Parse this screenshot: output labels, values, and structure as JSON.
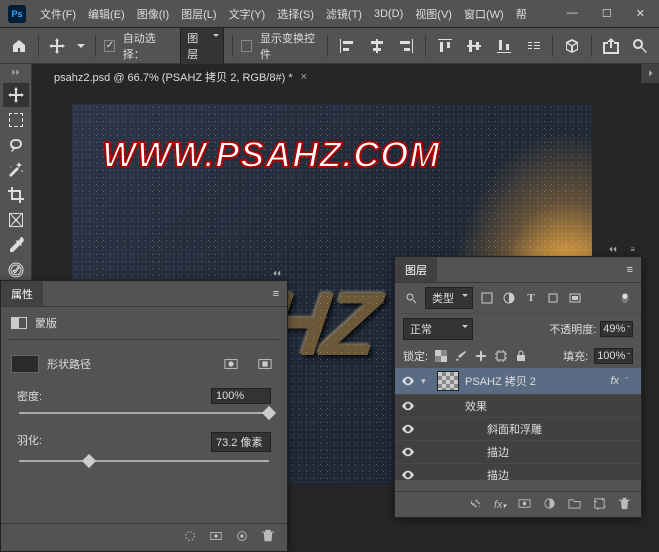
{
  "menu": {
    "file": "文件(F)",
    "edit": "编辑(E)",
    "image": "图像(I)",
    "layer": "图层(L)",
    "type": "文字(Y)",
    "select": "选择(S)",
    "filter": "滤镜(T)",
    "threed": "3D(D)",
    "view": "视图(V)",
    "window": "窗口(W)",
    "help": "帮"
  },
  "options": {
    "autoselect": "自动选择：",
    "target": "图层",
    "show_transform": "显示变换控件"
  },
  "tab": {
    "title": "psahz2.psd @ 66.7% (PSAHZ 拷贝 2, RGB/8#) *"
  },
  "canvas": {
    "watermark": "WWW.PSAHZ.COM",
    "emboss": "AHZ"
  },
  "props": {
    "title": "属性",
    "mask": "蒙版",
    "shape_path": "形状路径",
    "density": "密度:",
    "density_val": "100%",
    "feather": "羽化:",
    "feather_val": "73.2 像素"
  },
  "layers": {
    "title": "图层",
    "filter": "类型",
    "blend": "正常",
    "opacity_label": "不透明度:",
    "opacity_val": "49%",
    "lock_label": "锁定:",
    "fill_label": "填充:",
    "fill_val": "100%",
    "layer_name": "PSAHZ 拷贝 2",
    "fx": "fx",
    "effects": "效果",
    "bevel": "斜面和浮雕",
    "stroke": "描边",
    "stroke2": "描边"
  }
}
